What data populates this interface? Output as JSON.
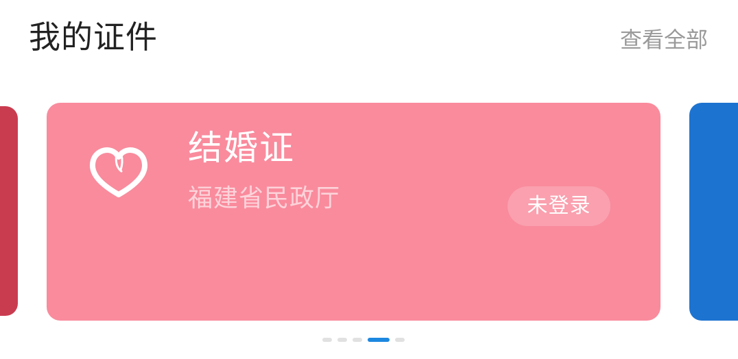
{
  "header": {
    "title": "我的证件",
    "view_all_label": "查看全部"
  },
  "carousel": {
    "active_card": {
      "title": "结婚证",
      "issuer": "福建省民政厅",
      "status": "未登录",
      "icon": "heart-icon"
    },
    "colors": {
      "active_card": "#f98b9d",
      "previous_card": "#c93c4f",
      "next_card": "#1d73d0",
      "indicator_active": "#1d88e0",
      "indicator_inactive": "#e1e1e1"
    },
    "indicator_count": 5,
    "active_index": 3
  }
}
